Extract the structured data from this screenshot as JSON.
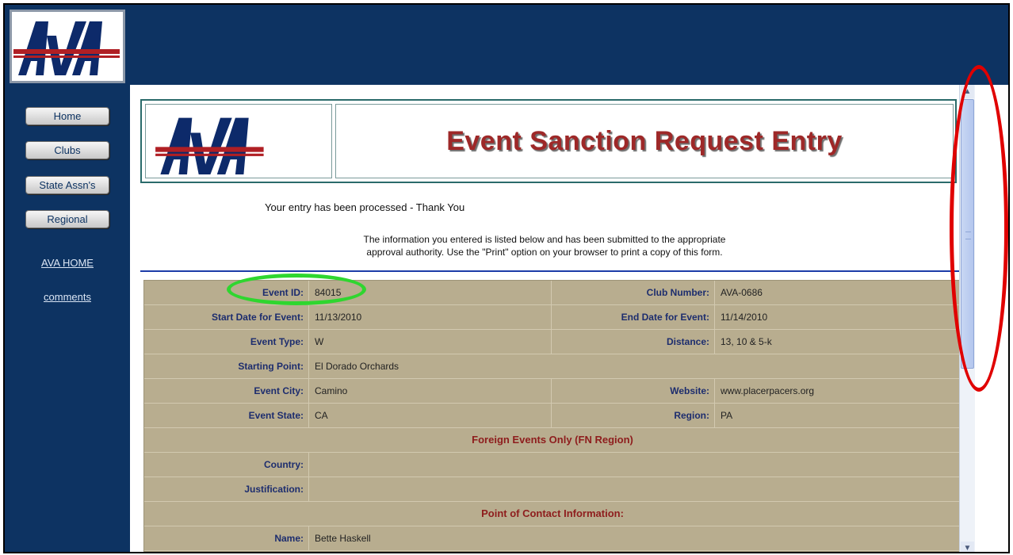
{
  "logo": {
    "text": "AVA"
  },
  "nav": {
    "buttons": [
      "Home",
      "Clubs",
      "State Assn's",
      "Regional"
    ],
    "links": [
      "AVA HOME",
      "comments"
    ]
  },
  "header": {
    "title": "Event Sanction Request Entry"
  },
  "messages": {
    "processed": "Your entry has been processed - Thank You",
    "info_line1": "The information you entered is listed below and has been submitted to the appropriate",
    "info_line2": "approval authority. Use the \"Print\" option on your browser to print a copy of this form."
  },
  "fields": {
    "event_id": {
      "label": "Event ID:",
      "value": "84015"
    },
    "club_number": {
      "label": "Club Number:",
      "value": "AVA-0686"
    },
    "start_date": {
      "label": "Start Date for Event:",
      "value": "11/13/2010"
    },
    "end_date": {
      "label": "End Date for Event:",
      "value": "11/14/2010"
    },
    "event_type": {
      "label": "Event Type:",
      "value": "W"
    },
    "distance": {
      "label": "Distance:",
      "value": "13, 10 & 5-k"
    },
    "starting_point": {
      "label": "Starting Point:",
      "value": "El Dorado Orchards"
    },
    "event_city": {
      "label": "Event City:",
      "value": "Camino"
    },
    "website": {
      "label": "Website:",
      "value": "www.placerpacers.org"
    },
    "event_state": {
      "label": "Event State:",
      "value": "CA"
    },
    "region": {
      "label": "Region:",
      "value": "PA"
    },
    "foreign_section": "Foreign Events Only (FN Region)",
    "country": {
      "label": "Country:",
      "value": ""
    },
    "justification": {
      "label": "Justification:",
      "value": ""
    },
    "contact_section": "Point of Contact Information:",
    "name": {
      "label": "Name:",
      "value": "Bette Haskell"
    }
  },
  "scrollbar": {
    "up_arrow": "up-arrow-icon",
    "down_arrow": "down-arrow-icon"
  },
  "annotations": {
    "green_oval_color": "#2fd62f",
    "red_oval_color": "#e00000"
  }
}
